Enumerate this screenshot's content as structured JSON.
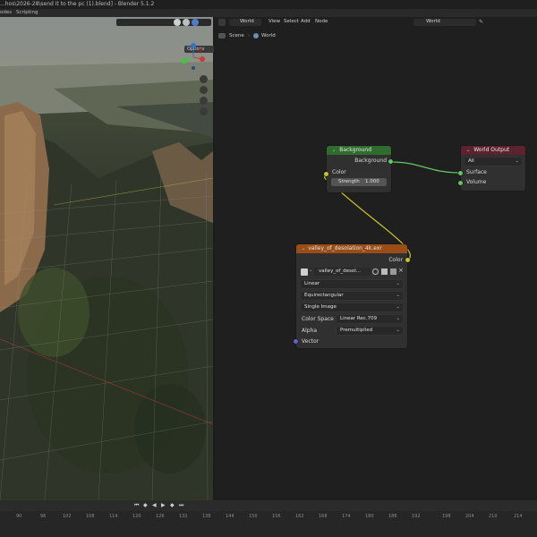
{
  "window": {
    "title": "...hos\\2026-28\\send it to the pc (1).blend] - Blender 5.1.2"
  },
  "menubar": {
    "items": [
      "odes",
      "Scripting"
    ]
  },
  "viewport": {
    "options_label": "Options"
  },
  "node_editor": {
    "header": {
      "world_selector": "World",
      "menus": [
        "View",
        "Select",
        "Add",
        "Node"
      ],
      "datablock": "World"
    },
    "breadcrumb": {
      "scene": "Scene",
      "world": "World"
    }
  },
  "nodes": {
    "background": {
      "title": "Background",
      "output": "Background",
      "input_color": "Color",
      "strength_label": "Strength",
      "strength_value": "1.000"
    },
    "world_output": {
      "title": "World Output",
      "target": "All",
      "surface": "Surface",
      "volume": "Volume"
    },
    "env_texture": {
      "title": "valley_of_desolation_4k.exr",
      "output": "Color",
      "image_name": "valley_of_desol...",
      "interpolation": "Linear",
      "projection": "Equirectangular",
      "source": "Single Image",
      "color_space_label": "Color Space",
      "color_space_value": "Linear Rec.709",
      "alpha_label": "Alpha",
      "alpha_value": "Premultiplied",
      "vector": "Vector"
    }
  },
  "timeline": {
    "ticks": [
      "90",
      "96",
      "102",
      "108",
      "114",
      "120",
      "126",
      "132",
      "138",
      "144",
      "150",
      "156",
      "162",
      "168",
      "174",
      "180",
      "186",
      "192",
      "198",
      "204",
      "210",
      "214"
    ]
  },
  "colors": {
    "background_header": "#2e6d2e",
    "output_header": "#7a2a3a",
    "texture_header": "#9a4d16",
    "color_socket": "#c7c729",
    "shader_socket": "#63c763",
    "vector_socket": "#6363c7"
  }
}
